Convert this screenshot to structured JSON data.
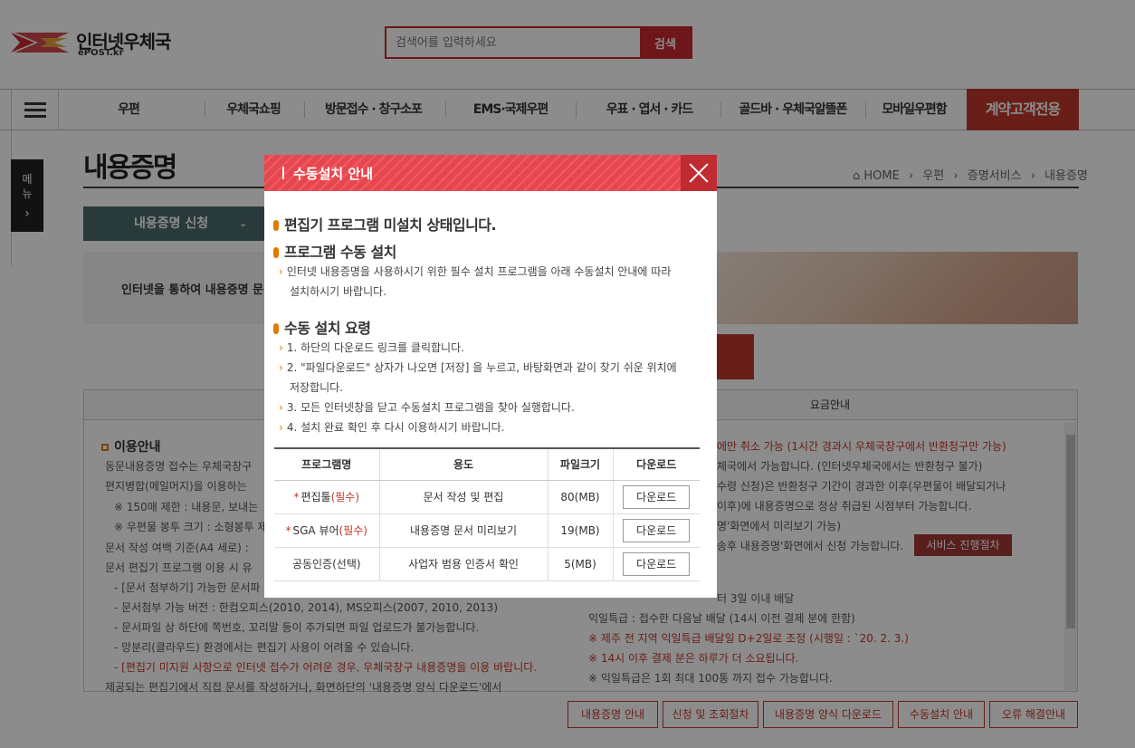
{
  "header": {
    "logo_title": "인터넷우체국",
    "logo_sub": "ePOST.kr",
    "search_placeholder": "검색어를 입력하세요",
    "search_button": "검색"
  },
  "gnb": {
    "items": [
      "우편",
      "우체국쇼핑",
      "방문접수 · 창구소포",
      "EMS·국제우편",
      "우표 · 엽서 · 카드",
      "골드바 · 우체국알뜰폰",
      "모바일우편함"
    ],
    "special": "계약고객전용"
  },
  "side_menu": {
    "label1": "메",
    "label2": "뉴",
    "arrow": "›"
  },
  "page": {
    "title": "내용증명",
    "breadcrumb": [
      "HOME",
      "우편",
      "증명서비스",
      "내용증명"
    ],
    "tab_label": "내용증명 신청",
    "intro_text": "인터넷을 통하여 내용증명 문",
    "tab_right_label": "요금안내"
  },
  "left_content": {
    "heading": "이용안내",
    "lines": [
      "동문내용증명 접수는 우체국창구",
      "편지병합(메일머지)을 이용하는",
      "※ 150매 제한 : 내용문, 보내는",
      "※ 우편물 봉투 크기 : 소형봉투 제",
      "문서 작성 여백 기준(A4 세로) :",
      "문서 편집기 프로그램 이용 시 유",
      "- [문서 첨부하기] 가능한 문서파",
      "- 문서첨부 가능 버전 : 한컴오피스(2010, 2014), MS오피스(2007, 2010, 2013)",
      "- 문서파일 상 하단에 쪽번호, 꼬리말 등이 추가되면 파일 업로드가 불가능합니다.",
      "- 망분리(클라우드) 환경에서는 편집기 사용이 어려울 수 있습니다.",
      "- [편집기 미지원 사항으로 인터넷 접수가 어려운 경우, 우체국창구 내용증명을 이용 바랍니다.",
      "제공되는 편집기에서 직접 문서를 작성하거나, 화면하단의 '내용증명 양식 다운로드'에서"
    ]
  },
  "right_content": {
    "lines": [
      "에만 취소 가능 (1시간 경과시 우체국창구에서 반환청구만 가능)",
      "체국에서 가능합니다. (인터넷우체국에서는 반환청구 불가)",
      "수령 신청)은 반환청구 기간이 경과한 이후(우편물이 배달되거나",
      "이후)에 내용증명으로 정상 취급된 시점부터 가능합니다.",
      "명'화면에서 미리보기 가능)",
      "송후 내용증명'화면에서 신청 가능합니다.",
      "터 3일 이내 배달",
      "익일특급 : 접수한 다음날 배달 (14시 이전 결제 분에 한함)",
      "※ 제주 전 지역 익일특급 배달일 D+2일로 조정 (시행일 : `20. 2. 3.)",
      "※ 14시 이후 결제 분은 하루가 더 소요됩니다.",
      "※ 익일특급은 1회 최대 100통 까지 접수 가능합니다."
    ],
    "service_button": "서비스 진행절차"
  },
  "bottom_buttons": [
    "내용증명 안내",
    "신청 및 조회절차",
    "내용증명 양식 다운로드",
    "수동설치 안내",
    "오류 해결안내"
  ],
  "modal": {
    "title": "수동설치 안내",
    "heading1": "편집기 프로그램 미설치 상태입니다.",
    "heading2": "프로그램 수동 설치",
    "desc_line1": "인터넷 내용증명을 사용하시기 위한 필수 설치 프로그램을 아래 수동설치 안내에 따라",
    "desc_line2": "설치하시기 바랍니다.",
    "heading3": "수동 설치 요령",
    "steps": [
      "1. 하단의 다운로드 링크를 클릭합니다.",
      "2. \"파일다운로드\" 상자가 나오면 [저장] 을 누르고, 바탕화면과 같이 찾기 쉬운 위치에",
      "저장합니다.",
      "3. 모든 인터넷창을 닫고 수동설치 프로그램을 찾아 실행합니다.",
      "4. 설치 완료 확인 후 다시 이용하시기 바랍니다."
    ],
    "table": {
      "headers": [
        "프로그램명",
        "용도",
        "파일크기",
        "다운로드"
      ],
      "rows": [
        {
          "name": "편집툴",
          "required": "(필수)",
          "starred": true,
          "purpose": "문서 작성 및 편집",
          "size": "80(MB)",
          "download": "다운로드"
        },
        {
          "name": "SGA 뷰어",
          "required": "(필수)",
          "starred": true,
          "purpose": "내용증명 문서 미리보기",
          "size": "19(MB)",
          "download": "다운로드"
        },
        {
          "name": "공동인증(선택)",
          "required": "",
          "starred": false,
          "purpose": "사업자 범용 인증서 확인",
          "size": "5(MB)",
          "download": "다운로드"
        }
      ]
    }
  }
}
